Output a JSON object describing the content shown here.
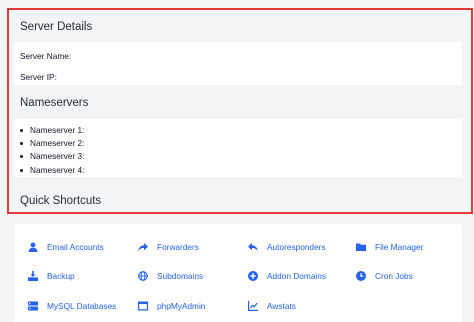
{
  "server_details": {
    "title": "Server Details",
    "server_name_label": "Server Name:",
    "server_ip_label": "Server IP:"
  },
  "nameservers": {
    "title": "Nameservers",
    "items": [
      "Nameserver 1:",
      "Nameserver 2:",
      "Nameserver 3:",
      "Nameserver 4:"
    ]
  },
  "quick_shortcuts": {
    "title": "Quick Shortcuts",
    "items": [
      {
        "label": "Email Accounts",
        "icon": "user-icon"
      },
      {
        "label": "Forwarders",
        "icon": "forward-arrow-icon"
      },
      {
        "label": "Autoresponders",
        "icon": "reply-arrow-icon"
      },
      {
        "label": "File Manager",
        "icon": "folder-icon"
      },
      {
        "label": "Backup",
        "icon": "backup-download-icon"
      },
      {
        "label": "Subdomains",
        "icon": "globe-icon"
      },
      {
        "label": "Addon Domains",
        "icon": "plus-circle-icon"
      },
      {
        "label": "Cron Jobs",
        "icon": "clock-icon"
      },
      {
        "label": "MySQL Databases",
        "icon": "server-icon"
      },
      {
        "label": "phpMyAdmin",
        "icon": "window-icon"
      },
      {
        "label": "Awstats",
        "icon": "line-chart-icon"
      }
    ]
  },
  "colors": {
    "link": "#2563eb",
    "highlight_border": "#e53935",
    "page_background": "#f3f4f6"
  }
}
